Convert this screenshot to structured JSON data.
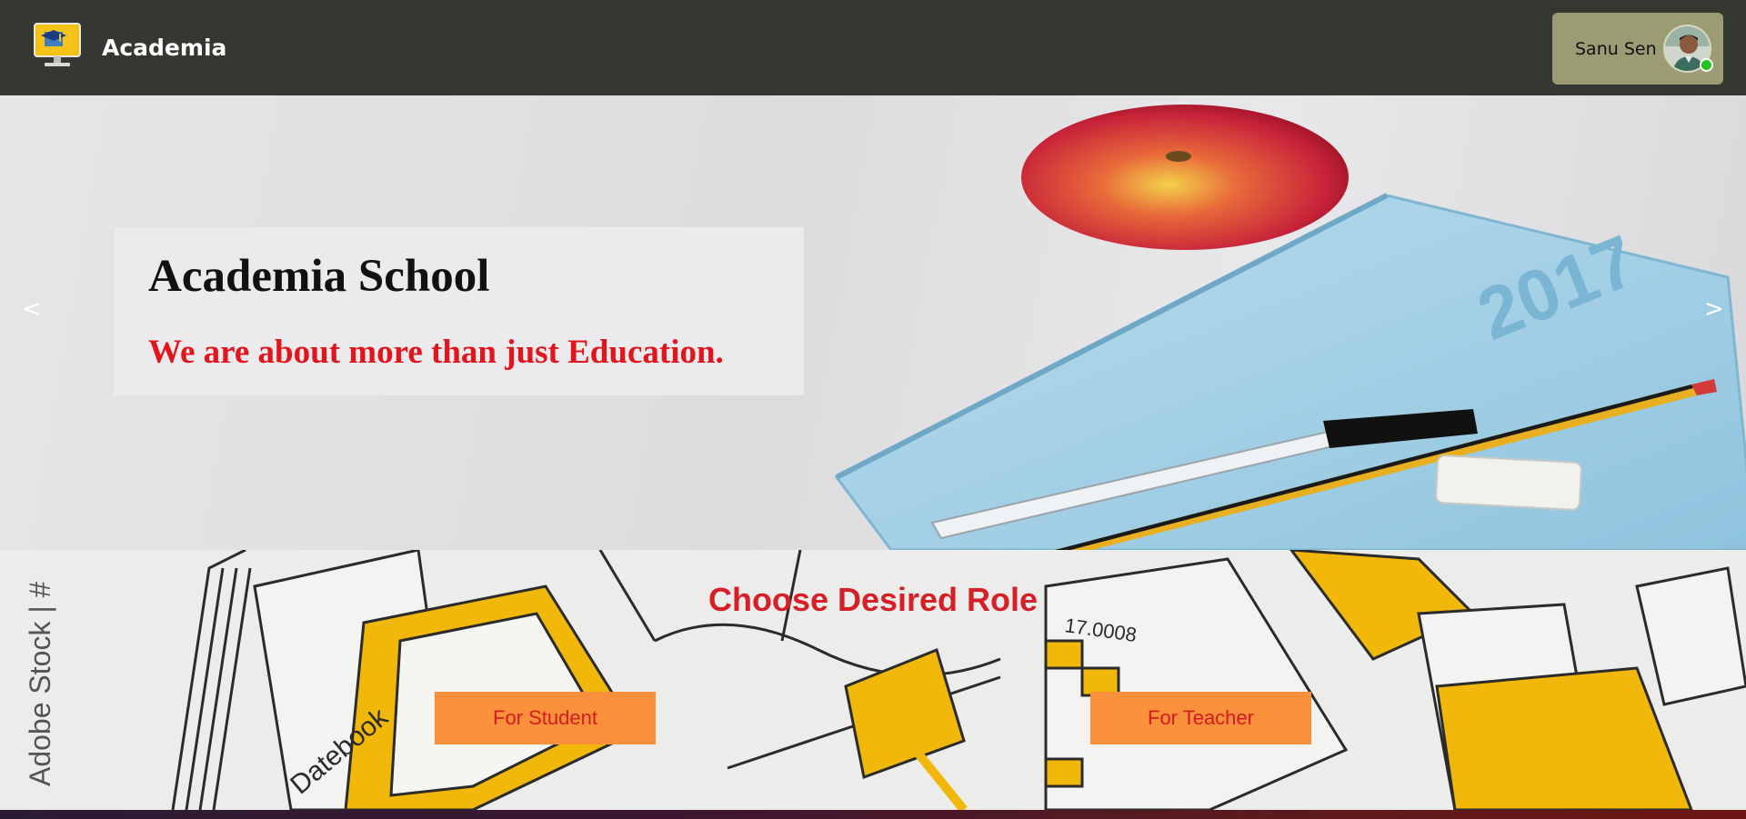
{
  "navbar": {
    "brand_name": "Academia",
    "user": {
      "name": "Sanu Sen",
      "status": "online"
    }
  },
  "hero": {
    "title": "Academia School",
    "subtitle": "We are about more than just Education.",
    "prev_label": "<",
    "next_label": ">",
    "notebook_year": "2017"
  },
  "role_section": {
    "title": "Choose Desired Role",
    "student_button": "For Student",
    "teacher_button": "For Teacher"
  },
  "colors": {
    "navbar_bg": "#353831",
    "user_chip_bg": "#9c9c74",
    "online": "#26c31c",
    "subtitle_red": "#e2141c",
    "role_title_red": "#d61f26",
    "button_orange": "#f9913c"
  },
  "icons": {
    "brand": "monitor-graduation-cap-icon",
    "avatar": "user-avatar",
    "status": "online-dot-icon"
  }
}
